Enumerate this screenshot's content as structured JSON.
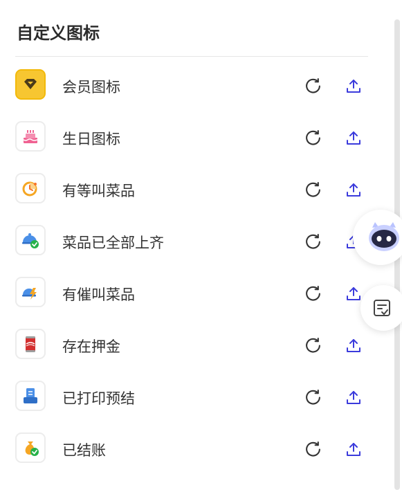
{
  "panel": {
    "title": "自定义图标"
  },
  "icons": [
    {
      "label": "会员图标",
      "icon": "vip-diamond-icon"
    },
    {
      "label": "生日图标",
      "icon": "birthday-cake-icon"
    },
    {
      "label": "有等叫菜品",
      "icon": "waiting-clock-icon"
    },
    {
      "label": "菜品已全部上齐",
      "icon": "dish-served-check-icon"
    },
    {
      "label": "有催叫菜品",
      "icon": "urge-lightning-icon"
    },
    {
      "label": "存在押金",
      "icon": "cola-can-deposit-icon"
    },
    {
      "label": "已打印预结",
      "icon": "printer-receipt-icon"
    },
    {
      "label": "已结账",
      "icon": "money-bag-check-icon"
    }
  ],
  "colors": {
    "accent": "#3b3bdc",
    "vip_bg": "#f7c631",
    "check_green": "#27b24a"
  }
}
